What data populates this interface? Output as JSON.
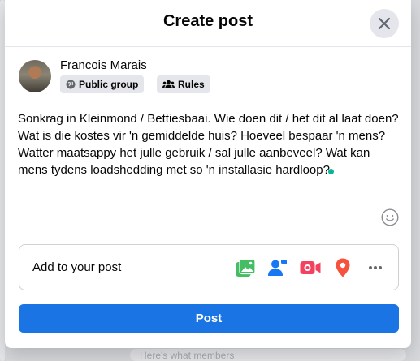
{
  "modal": {
    "title": "Create post"
  },
  "author": {
    "name": "Francois Marais",
    "audience_label": "Public group",
    "rules_label": "Rules"
  },
  "composer": {
    "text": "Sonkrag in Kleinmond / Bettiesbaai. Wie doen dit / het dit al laat doen? Wat is die kostes vir 'n gemiddelde huis? Hoeveel bespaar 'n mens? Watter maatsappy het julle gebruik / sal julle aanbeveel? Wat kan mens tydens loadshedding met so 'n installasie hardloop?"
  },
  "add_to_post": {
    "label": "Add to your post",
    "icons": [
      "photo-video-icon",
      "tag-people-icon",
      "live-video-icon",
      "check-in-icon",
      "more-icon"
    ]
  },
  "actions": {
    "post_label": "Post"
  },
  "background": {
    "visible_text": "Here's what members"
  },
  "colors": {
    "primary": "#1b74e4",
    "photo_green": "#45bd62",
    "tag_blue": "#1877f2",
    "live_red": "#f3425f",
    "location_red": "#f5533d"
  }
}
